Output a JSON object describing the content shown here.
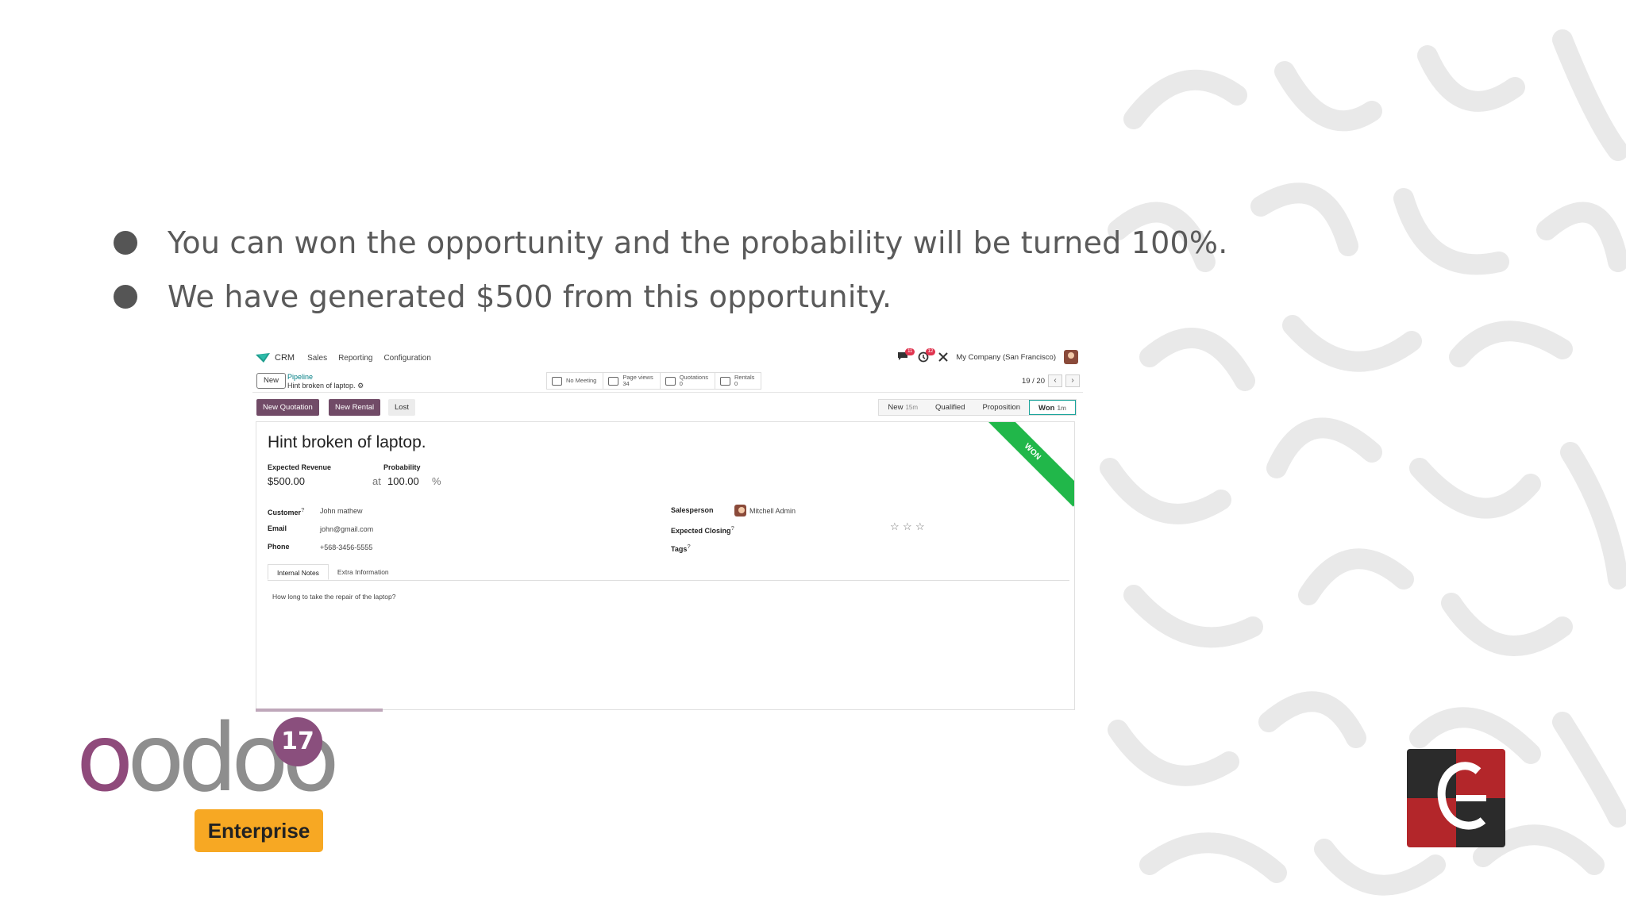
{
  "bullets": [
    "You can won the opportunity and the probability will be turned 100%.",
    "We have generated $500 from this opportunity."
  ],
  "screenshot": {
    "app_name": "CRM",
    "menu": [
      "Sales",
      "Reporting",
      "Configuration"
    ],
    "messages_count": "11",
    "activities_count": "12",
    "company": "My Company (San Francisco)",
    "new_button": "New",
    "breadcrumb_parent": "Pipeline",
    "breadcrumb_current": "Hint broken of laptop.",
    "smart_buttons": [
      {
        "label": "No Meeting",
        "value": "",
        "icon": "calendar-icon"
      },
      {
        "label": "Page views",
        "value": "34",
        "icon": "tags-icon"
      },
      {
        "label": "Quotations",
        "value": "0",
        "icon": "edit-icon"
      },
      {
        "label": "Rentals",
        "value": "0",
        "icon": "edit-icon"
      }
    ],
    "pager": "19 / 20",
    "actions": {
      "new_quotation": "New Quotation",
      "new_rental": "New Rental",
      "lost": "Lost"
    },
    "stages": [
      {
        "name": "New",
        "time": "15m"
      },
      {
        "name": "Qualified",
        "time": ""
      },
      {
        "name": "Proposition",
        "time": ""
      },
      {
        "name": "Won",
        "time": "1m",
        "active": true
      }
    ],
    "ribbon": "WON",
    "title": "Hint broken of laptop.",
    "expected_revenue_label": "Expected Revenue",
    "expected_revenue": "$500.00",
    "probability_label": "Probability",
    "probability_at": "at",
    "probability": "100.00",
    "probability_unit": "%",
    "customer_label": "Customer",
    "customer": "John mathew",
    "email_label": "Email",
    "email": "john@gmail.com",
    "phone_label": "Phone",
    "phone": "+568-3456-5555",
    "salesperson_label": "Salesperson",
    "salesperson": "Mitchell Admin",
    "expected_closing_label": "Expected Closing",
    "tags_label": "Tags",
    "help_mark": "?",
    "priority_stars": 0,
    "tabs": [
      "Internal Notes",
      "Extra Information"
    ],
    "notes": "How long to take the repair of the laptop?"
  },
  "logo": {
    "brand": "odoo",
    "version": "17",
    "edition": "Enterprise"
  },
  "colors": {
    "primary": "#714b67",
    "won_ribbon": "#21b74a",
    "enterprise_badge": "#f7a823",
    "cybrosys_red": "#b3262a"
  }
}
